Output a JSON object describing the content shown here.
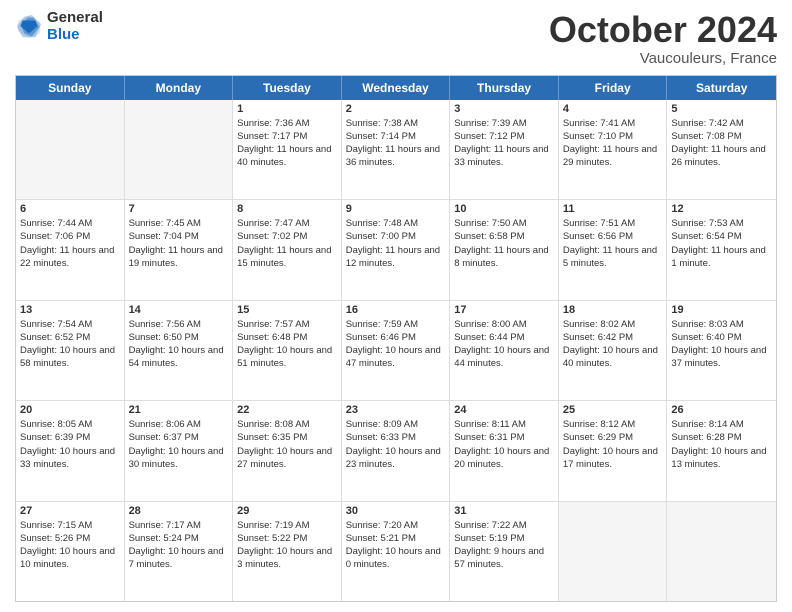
{
  "header": {
    "logo_general": "General",
    "logo_blue": "Blue",
    "title": "October 2024",
    "location": "Vaucouleurs, France"
  },
  "days_of_week": [
    "Sunday",
    "Monday",
    "Tuesday",
    "Wednesday",
    "Thursday",
    "Friday",
    "Saturday"
  ],
  "weeks": [
    [
      {
        "day": "",
        "sunrise": "",
        "sunset": "",
        "daylight": "",
        "empty": true
      },
      {
        "day": "",
        "sunrise": "",
        "sunset": "",
        "daylight": "",
        "empty": true
      },
      {
        "day": "1",
        "sunrise": "Sunrise: 7:36 AM",
        "sunset": "Sunset: 7:17 PM",
        "daylight": "Daylight: 11 hours and 40 minutes.",
        "empty": false
      },
      {
        "day": "2",
        "sunrise": "Sunrise: 7:38 AM",
        "sunset": "Sunset: 7:14 PM",
        "daylight": "Daylight: 11 hours and 36 minutes.",
        "empty": false
      },
      {
        "day": "3",
        "sunrise": "Sunrise: 7:39 AM",
        "sunset": "Sunset: 7:12 PM",
        "daylight": "Daylight: 11 hours and 33 minutes.",
        "empty": false
      },
      {
        "day": "4",
        "sunrise": "Sunrise: 7:41 AM",
        "sunset": "Sunset: 7:10 PM",
        "daylight": "Daylight: 11 hours and 29 minutes.",
        "empty": false
      },
      {
        "day": "5",
        "sunrise": "Sunrise: 7:42 AM",
        "sunset": "Sunset: 7:08 PM",
        "daylight": "Daylight: 11 hours and 26 minutes.",
        "empty": false
      }
    ],
    [
      {
        "day": "6",
        "sunrise": "Sunrise: 7:44 AM",
        "sunset": "Sunset: 7:06 PM",
        "daylight": "Daylight: 11 hours and 22 minutes.",
        "empty": false
      },
      {
        "day": "7",
        "sunrise": "Sunrise: 7:45 AM",
        "sunset": "Sunset: 7:04 PM",
        "daylight": "Daylight: 11 hours and 19 minutes.",
        "empty": false
      },
      {
        "day": "8",
        "sunrise": "Sunrise: 7:47 AM",
        "sunset": "Sunset: 7:02 PM",
        "daylight": "Daylight: 11 hours and 15 minutes.",
        "empty": false
      },
      {
        "day": "9",
        "sunrise": "Sunrise: 7:48 AM",
        "sunset": "Sunset: 7:00 PM",
        "daylight": "Daylight: 11 hours and 12 minutes.",
        "empty": false
      },
      {
        "day": "10",
        "sunrise": "Sunrise: 7:50 AM",
        "sunset": "Sunset: 6:58 PM",
        "daylight": "Daylight: 11 hours and 8 minutes.",
        "empty": false
      },
      {
        "day": "11",
        "sunrise": "Sunrise: 7:51 AM",
        "sunset": "Sunset: 6:56 PM",
        "daylight": "Daylight: 11 hours and 5 minutes.",
        "empty": false
      },
      {
        "day": "12",
        "sunrise": "Sunrise: 7:53 AM",
        "sunset": "Sunset: 6:54 PM",
        "daylight": "Daylight: 11 hours and 1 minute.",
        "empty": false
      }
    ],
    [
      {
        "day": "13",
        "sunrise": "Sunrise: 7:54 AM",
        "sunset": "Sunset: 6:52 PM",
        "daylight": "Daylight: 10 hours and 58 minutes.",
        "empty": false
      },
      {
        "day": "14",
        "sunrise": "Sunrise: 7:56 AM",
        "sunset": "Sunset: 6:50 PM",
        "daylight": "Daylight: 10 hours and 54 minutes.",
        "empty": false
      },
      {
        "day": "15",
        "sunrise": "Sunrise: 7:57 AM",
        "sunset": "Sunset: 6:48 PM",
        "daylight": "Daylight: 10 hours and 51 minutes.",
        "empty": false
      },
      {
        "day": "16",
        "sunrise": "Sunrise: 7:59 AM",
        "sunset": "Sunset: 6:46 PM",
        "daylight": "Daylight: 10 hours and 47 minutes.",
        "empty": false
      },
      {
        "day": "17",
        "sunrise": "Sunrise: 8:00 AM",
        "sunset": "Sunset: 6:44 PM",
        "daylight": "Daylight: 10 hours and 44 minutes.",
        "empty": false
      },
      {
        "day": "18",
        "sunrise": "Sunrise: 8:02 AM",
        "sunset": "Sunset: 6:42 PM",
        "daylight": "Daylight: 10 hours and 40 minutes.",
        "empty": false
      },
      {
        "day": "19",
        "sunrise": "Sunrise: 8:03 AM",
        "sunset": "Sunset: 6:40 PM",
        "daylight": "Daylight: 10 hours and 37 minutes.",
        "empty": false
      }
    ],
    [
      {
        "day": "20",
        "sunrise": "Sunrise: 8:05 AM",
        "sunset": "Sunset: 6:39 PM",
        "daylight": "Daylight: 10 hours and 33 minutes.",
        "empty": false
      },
      {
        "day": "21",
        "sunrise": "Sunrise: 8:06 AM",
        "sunset": "Sunset: 6:37 PM",
        "daylight": "Daylight: 10 hours and 30 minutes.",
        "empty": false
      },
      {
        "day": "22",
        "sunrise": "Sunrise: 8:08 AM",
        "sunset": "Sunset: 6:35 PM",
        "daylight": "Daylight: 10 hours and 27 minutes.",
        "empty": false
      },
      {
        "day": "23",
        "sunrise": "Sunrise: 8:09 AM",
        "sunset": "Sunset: 6:33 PM",
        "daylight": "Daylight: 10 hours and 23 minutes.",
        "empty": false
      },
      {
        "day": "24",
        "sunrise": "Sunrise: 8:11 AM",
        "sunset": "Sunset: 6:31 PM",
        "daylight": "Daylight: 10 hours and 20 minutes.",
        "empty": false
      },
      {
        "day": "25",
        "sunrise": "Sunrise: 8:12 AM",
        "sunset": "Sunset: 6:29 PM",
        "daylight": "Daylight: 10 hours and 17 minutes.",
        "empty": false
      },
      {
        "day": "26",
        "sunrise": "Sunrise: 8:14 AM",
        "sunset": "Sunset: 6:28 PM",
        "daylight": "Daylight: 10 hours and 13 minutes.",
        "empty": false
      }
    ],
    [
      {
        "day": "27",
        "sunrise": "Sunrise: 7:15 AM",
        "sunset": "Sunset: 5:26 PM",
        "daylight": "Daylight: 10 hours and 10 minutes.",
        "empty": false
      },
      {
        "day": "28",
        "sunrise": "Sunrise: 7:17 AM",
        "sunset": "Sunset: 5:24 PM",
        "daylight": "Daylight: 10 hours and 7 minutes.",
        "empty": false
      },
      {
        "day": "29",
        "sunrise": "Sunrise: 7:19 AM",
        "sunset": "Sunset: 5:22 PM",
        "daylight": "Daylight: 10 hours and 3 minutes.",
        "empty": false
      },
      {
        "day": "30",
        "sunrise": "Sunrise: 7:20 AM",
        "sunset": "Sunset: 5:21 PM",
        "daylight": "Daylight: 10 hours and 0 minutes.",
        "empty": false
      },
      {
        "day": "31",
        "sunrise": "Sunrise: 7:22 AM",
        "sunset": "Sunset: 5:19 PM",
        "daylight": "Daylight: 9 hours and 57 minutes.",
        "empty": false
      },
      {
        "day": "",
        "sunrise": "",
        "sunset": "",
        "daylight": "",
        "empty": true
      },
      {
        "day": "",
        "sunrise": "",
        "sunset": "",
        "daylight": "",
        "empty": true
      }
    ]
  ]
}
